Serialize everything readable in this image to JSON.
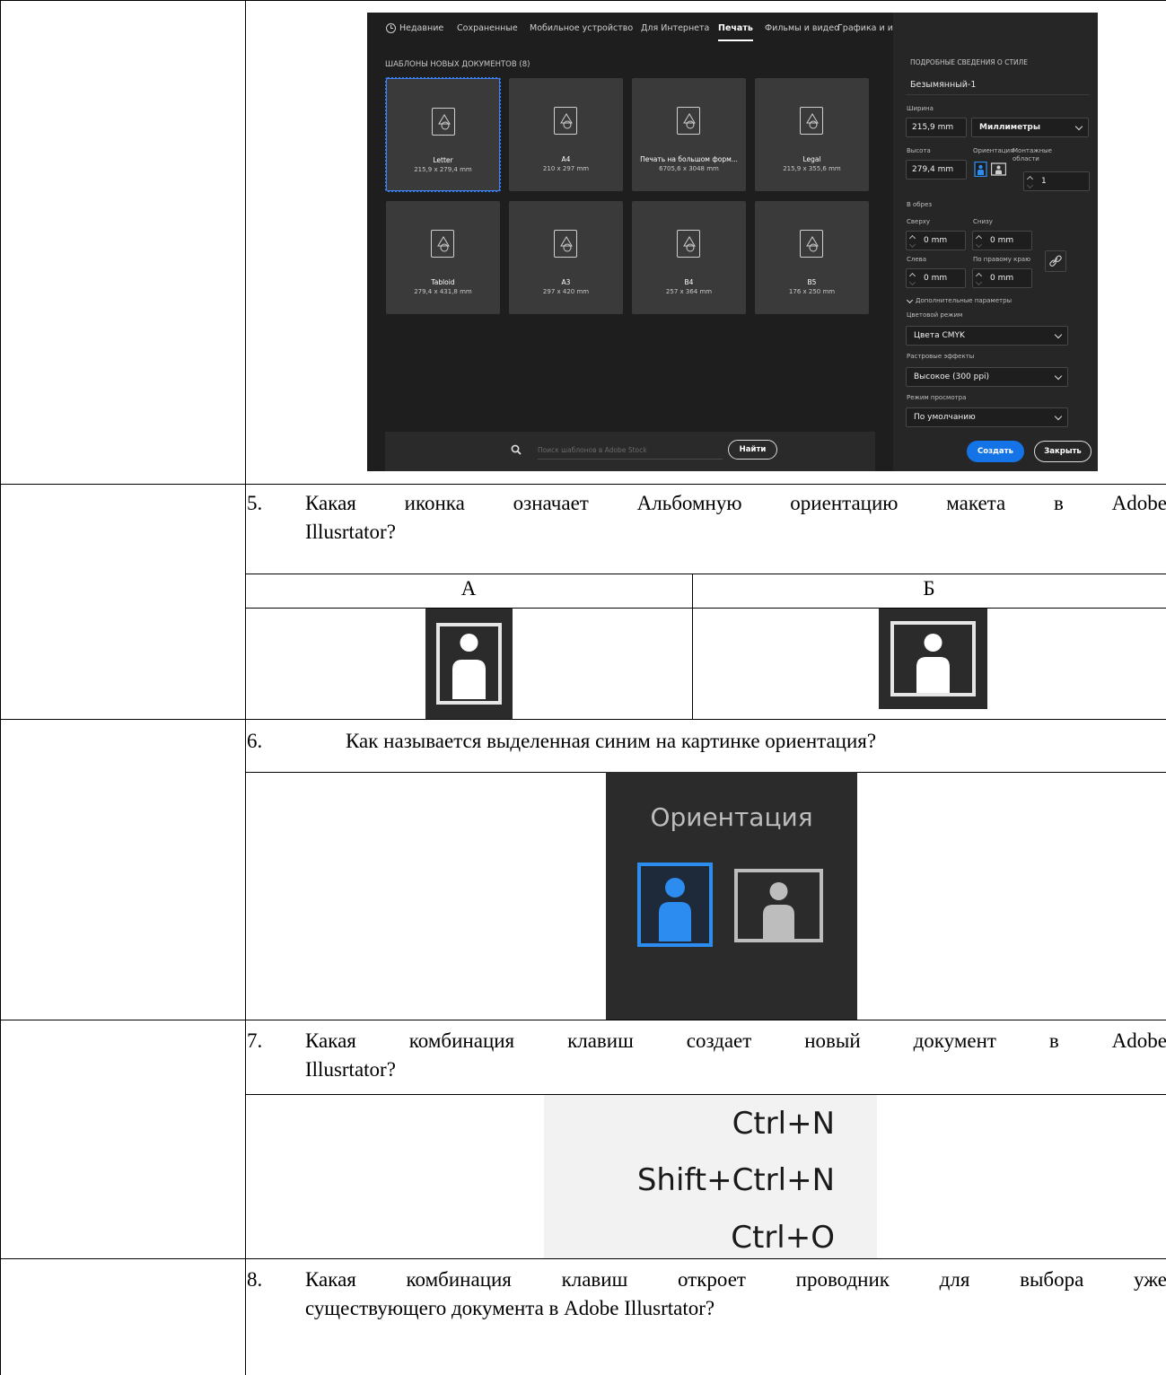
{
  "illustrator_dialog": {
    "tabs": [
      {
        "label": "Недавние",
        "active": false
      },
      {
        "label": "Сохраненные",
        "active": false
      },
      {
        "label": "Мобильное устройство",
        "active": false
      },
      {
        "label": "Для Интернета",
        "active": false
      },
      {
        "label": "Печать",
        "active": true
      },
      {
        "label": "Фильмы и видео",
        "active": false
      },
      {
        "label": "Графика и иллюстрации",
        "active": false
      }
    ],
    "section_title": "ШАБЛОНЫ НОВЫХ ДОКУМЕНТОВ (8)",
    "templates": [
      {
        "name": "Letter",
        "size": "215,9 x 279,4 mm",
        "selected": true
      },
      {
        "name": "A4",
        "size": "210 x 297 mm",
        "selected": false
      },
      {
        "name": "Печать на большом форм...",
        "size": "6705,6 x 3048 mm",
        "selected": false
      },
      {
        "name": "Legal",
        "size": "215,9 x 355,6 mm",
        "selected": false
      },
      {
        "name": "Tabloid",
        "size": "279,4 x 431,8 mm",
        "selected": false
      },
      {
        "name": "A3",
        "size": "297 x 420 mm",
        "selected": false
      },
      {
        "name": "B4",
        "size": "257 x 364 mm",
        "selected": false
      },
      {
        "name": "B5",
        "size": "176 x 250 mm",
        "selected": false
      }
    ],
    "search": {
      "placeholder": "Поиск шаблонов в Adobe Stock",
      "button": "Найти"
    },
    "panel": {
      "heading": "ПОДРОБНЫЕ СВЕДЕНИЯ О СТИЛЕ",
      "doc_name": "Безымянный-1",
      "width_label": "Ширина",
      "width_value": "215,9 mm",
      "units": "Миллиметры",
      "height_label": "Высота",
      "height_value": "279,4 mm",
      "orientation_label": "Ориентация",
      "artboards_label": "Монтажные области",
      "artboards_value": "1",
      "bleed_label": "В обрез",
      "top_label": "Сверху",
      "top_value": "0 mm",
      "bottom_label": "Снизу",
      "bottom_value": "0 mm",
      "left_label": "Слева",
      "left_value": "0 mm",
      "right_label": "По правому краю",
      "right_value": "0 mm",
      "advanced_label": "Дополнительные параметры",
      "color_mode_label": "Цветовой режим",
      "color_mode_value": "Цвета CMYK",
      "raster_label": "Растровые эффекты",
      "raster_value": "Высокое (300 ppi)",
      "preview_label": "Режим просмотра",
      "preview_value": "По умолчанию",
      "create_button": "Создать",
      "close_button": "Закрыть"
    }
  },
  "questions": [
    {
      "number": "5.",
      "line1": "Какая иконка означает Альбомную ориентацию макета в Adobe",
      "line2": "Illusrtator?"
    },
    {
      "number": "6.",
      "line1": "Как называется выделенная синим на картинке ориентация?"
    },
    {
      "number": "7.",
      "line1": "Какая комбинация клавиш создает новый документ в Adobe",
      "line2": "Illusrtator?"
    },
    {
      "number": "8.",
      "line1": "Какая комбинация клавиш откроет проводник для выбора уже",
      "line2": "существующего документа в Adobe Illusrtator?"
    }
  ],
  "answer_columns": {
    "a": "А",
    "b": "Б"
  },
  "orientation_image_title": "Ориентация",
  "shortcuts": [
    "Ctrl+N",
    "Shift+Ctrl+N",
    "Ctrl+O"
  ],
  "colors": {
    "selected_blue": "#2d8cf0",
    "accent_button": "#1473e6",
    "dark_bg": "#1e1e1e"
  }
}
